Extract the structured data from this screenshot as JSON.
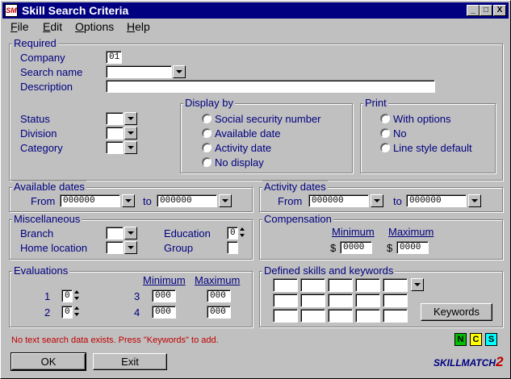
{
  "window": {
    "title": "Skill Search Criteria",
    "icon_text": "SM",
    "minimize": "_",
    "maximize": "□",
    "close": "X"
  },
  "menu": {
    "file": {
      "u": "F",
      "r": "ile"
    },
    "edit": {
      "u": "E",
      "r": "dit"
    },
    "options": {
      "u": "O",
      "r": "ptions"
    },
    "help": {
      "u": "H",
      "r": "elp"
    }
  },
  "required": {
    "title": "Required",
    "company_label": "Company",
    "company_value": "01",
    "search_name_label": "Search name",
    "search_name_value": "",
    "description_label": "Description",
    "description_value": "",
    "status_label": "Status",
    "division_label": "Division",
    "category_label": "Category"
  },
  "display_by": {
    "title": "Display by",
    "options": [
      "Social security number",
      "Available date",
      "Activity date",
      "No display"
    ]
  },
  "print": {
    "title": "Print",
    "options": [
      "With options",
      "No",
      "Line style default"
    ]
  },
  "available_dates": {
    "title": "Available dates",
    "from_label": "From",
    "from_value": "000000",
    "to_label": "to",
    "to_value": "000000"
  },
  "activity_dates": {
    "title": "Activity dates",
    "from_label": "From",
    "from_value": "000000",
    "to_label": "to",
    "to_value": "000000"
  },
  "miscellaneous": {
    "title": "Miscellaneous",
    "branch_label": "Branch",
    "home_location_label": "Home location",
    "education_label": "Education",
    "education_value": "0",
    "group_label": "Group"
  },
  "compensation": {
    "title": "Compensation",
    "min_label": "Minimum",
    "max_label": "Maximum",
    "currency": "$",
    "min_value": "0000",
    "max_value": "0000"
  },
  "evaluations": {
    "title": "Evaluations",
    "min_label": "Minimum",
    "max_label": "Maximum",
    "rows": [
      {
        "n": "1",
        "v": "0"
      },
      {
        "n": "2",
        "v": "0"
      }
    ],
    "range_rows": [
      {
        "n": "3",
        "min": "000",
        "max": "000"
      },
      {
        "n": "4",
        "min": "000",
        "max": "000"
      }
    ]
  },
  "defined_skills": {
    "title": "Defined skills and keywords",
    "keywords_button": "Keywords"
  },
  "status_message": "No text search data exists. Press \"Keywords\" to add.",
  "badges": {
    "n": "N",
    "c": "C",
    "s": "S",
    "colors": {
      "n": "#00c000",
      "c": "#ffff00",
      "s": "#00ffff"
    }
  },
  "buttons": {
    "ok": "OK",
    "exit": "Exit"
  },
  "logo": {
    "part1": "SKILLMATCH",
    "part2": "2"
  }
}
